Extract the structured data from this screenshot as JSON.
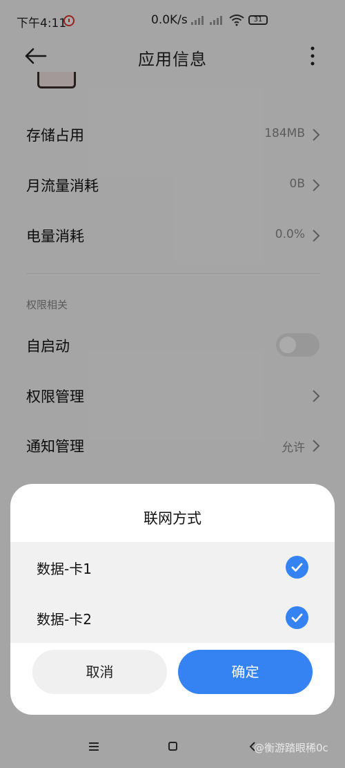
{
  "status_bar": {
    "time": "下午4:11",
    "net_speed": "0.0K/s",
    "battery": "31"
  },
  "header": {
    "title": "应用信息"
  },
  "rows": [
    {
      "label": "存储占用",
      "value": "184MB"
    },
    {
      "label": "月流量消耗",
      "value": "0B"
    },
    {
      "label": "电量消耗",
      "value": "0.0%"
    }
  ],
  "permissions": {
    "section_label": "权限相关",
    "autostart_label": "自启动",
    "autostart_enabled": false,
    "manage_label": "权限管理",
    "notify_label": "通知管理",
    "notify_value": "允许"
  },
  "dialog": {
    "title": "联网方式",
    "options": [
      {
        "label": "数据-卡1",
        "checked": true
      },
      {
        "label": "数据-卡2",
        "checked": true
      }
    ],
    "cancel_label": "取消",
    "ok_label": "确定"
  },
  "watermark": "@衡游踏眼稀0c",
  "colors": {
    "accent": "#3582f2",
    "overlay": "rgba(0,0,0,0.33)"
  }
}
